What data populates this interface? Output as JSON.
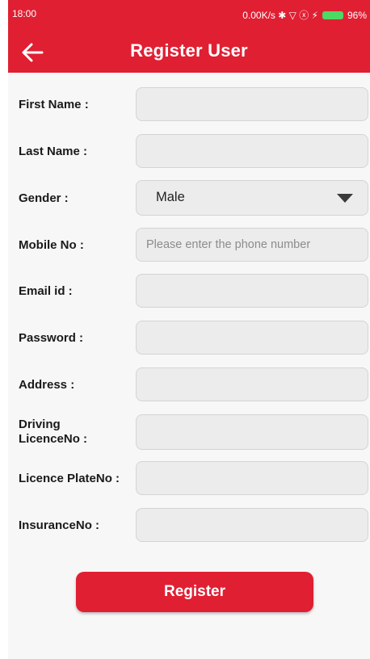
{
  "status_bar": {
    "time": "18:00",
    "right_text": "0.00K/s ✱ ▽ ⓧ ⚡",
    "battery": "96%"
  },
  "header": {
    "title": "Register User",
    "back_icon": "arrow-left-icon"
  },
  "form": {
    "first_name": {
      "label": "First Name :",
      "value": ""
    },
    "last_name": {
      "label": "Last Name :",
      "value": ""
    },
    "gender": {
      "label": "Gender :",
      "value": "Male"
    },
    "mobile": {
      "label": "Mobile No :",
      "placeholder": "Please enter the phone number"
    },
    "email": {
      "label": "Email id :",
      "value": ""
    },
    "password": {
      "label": "Password :",
      "value": ""
    },
    "address": {
      "label": "Address :",
      "value": ""
    },
    "driving_licence": {
      "label_line1": "Driving",
      "label_line2": "LicenceNo :",
      "value": ""
    },
    "licence_plate": {
      "label": "Licence PlateNo :",
      "value": ""
    },
    "insurance": {
      "label": "InsuranceNo :",
      "value": ""
    }
  },
  "register_button": {
    "label": "Register"
  },
  "colors": {
    "brand": "#e01f33",
    "field_bg": "#ececec",
    "page_bg": "#f7f7f7"
  }
}
